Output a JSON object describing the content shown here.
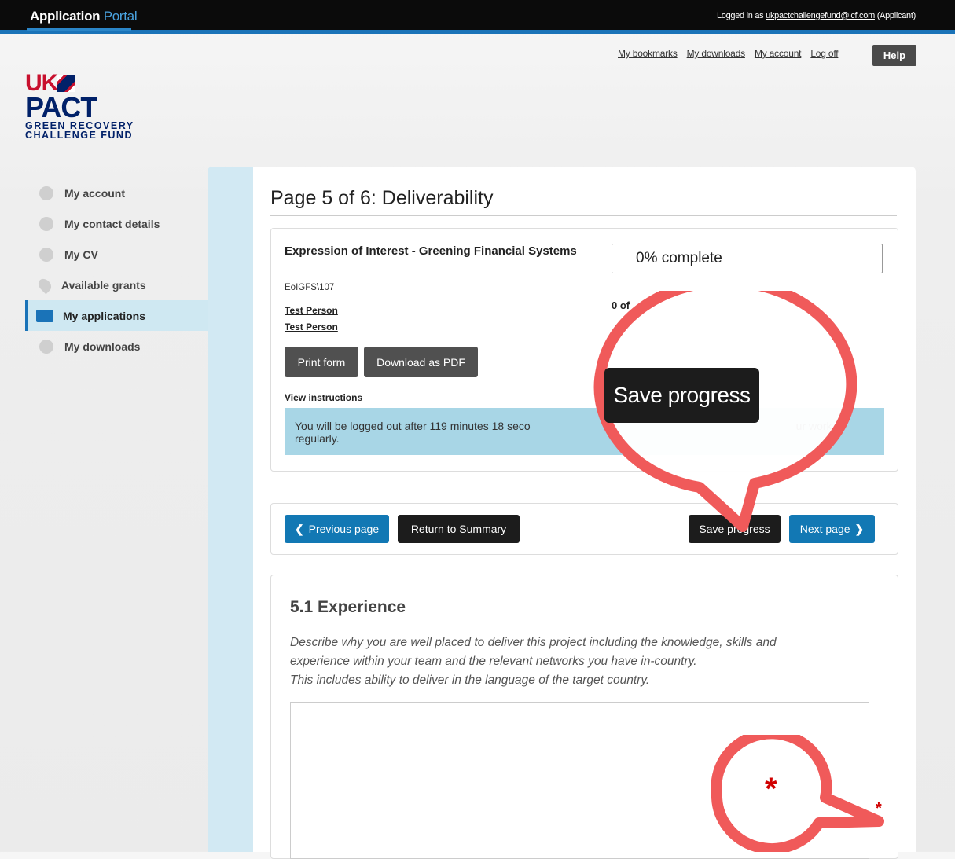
{
  "topbar": {
    "brand_app": "Application",
    "brand_portal": "Portal",
    "login_prefix": "Logged in as",
    "login_email": "ukpactchallengefund@icf.com",
    "login_role": "(Applicant)"
  },
  "util_links": [
    "My bookmarks",
    "My downloads",
    "My account",
    "Log off"
  ],
  "help_label": "Help",
  "logo": {
    "uk": "UK",
    "pact": "PACT",
    "line1": "GREEN RECOVERY",
    "line2": "CHALLENGE FUND"
  },
  "sidebar": {
    "items": [
      {
        "label": "My account",
        "icon": "users-icon"
      },
      {
        "label": "My contact details",
        "icon": "person-icon"
      },
      {
        "label": "My CV",
        "icon": "cv-icon"
      },
      {
        "label": "Available grants",
        "icon": "location-pin-icon"
      },
      {
        "label": "My applications",
        "icon": "applications-icon",
        "active": true
      },
      {
        "label": "My downloads",
        "icon": "download-icon"
      }
    ]
  },
  "main": {
    "page_title": "Page 5 of 6: Deliverability",
    "form_name": "Expression of Interest - Greening Financial Systems",
    "form_ref": "EoIGFS\\107",
    "person1": "Test Person",
    "person2": "Test Person",
    "progress_label": "0% complete",
    "progress_percent": 0,
    "progress_sub": "0 of",
    "print_label": "Print form",
    "pdf_label": "Download as PDF",
    "view_instructions": "View instructions",
    "logout_text_a": "You will be logged out after 119 minutes 18 seco",
    "logout_text_b": "ur work",
    "logout_text_c": "regularly."
  },
  "nav": {
    "prev_label": "Previous page",
    "summary_label": "Return to Summary",
    "save_label": "Save progress",
    "next_label": "Next page"
  },
  "question": {
    "title": "5.1 Experience",
    "desc_1": "Describe why you are well placed to deliver this project including the knowledge, skills and",
    "desc_2": "experience within your team and the relevant networks you have in-country.",
    "desc_3": "This includes ability to deliver in the language of the target country.",
    "required_mark": "*"
  },
  "callouts": {
    "save_label": "Save progress",
    "star": "*",
    "ring_color": "#f05a5a"
  }
}
